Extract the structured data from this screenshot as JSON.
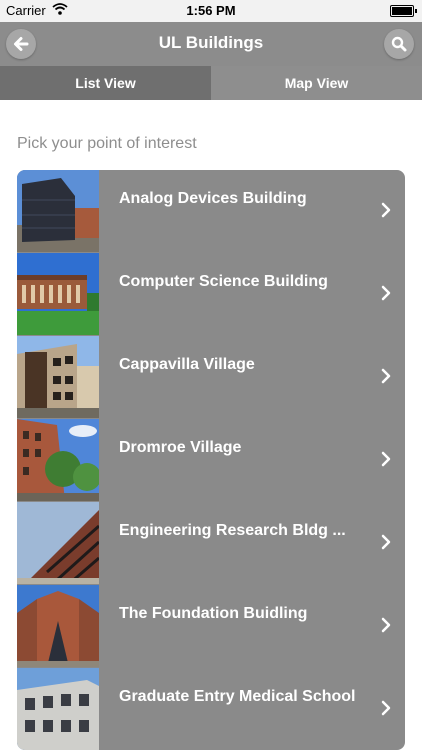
{
  "status_bar": {
    "carrier": "Carrier",
    "time": "1:56 PM"
  },
  "nav": {
    "title": "UL Buildings",
    "back_icon": "back-arrow-icon",
    "search_icon": "search-icon"
  },
  "tabs": [
    {
      "label": "List View",
      "active": true
    },
    {
      "label": "Map View",
      "active": false
    }
  ],
  "prompt": "Pick your point of interest",
  "buildings": [
    {
      "name": "Analog Devices Building"
    },
    {
      "name": "Computer Science Building"
    },
    {
      "name": "Cappavilla Village"
    },
    {
      "name": "Dromroe Village"
    },
    {
      "name": "Engineering Research Bldg ..."
    },
    {
      "name": "The Foundation Buidling"
    },
    {
      "name": "Graduate Entry Medical School"
    }
  ],
  "colors": {
    "nav_bg": "#8c8c8c",
    "tab_active": "#6f6f6f",
    "tab_inactive": "#8e8e8e",
    "list_bg": "#8a8a8a",
    "prompt": "#8e8e8e"
  }
}
